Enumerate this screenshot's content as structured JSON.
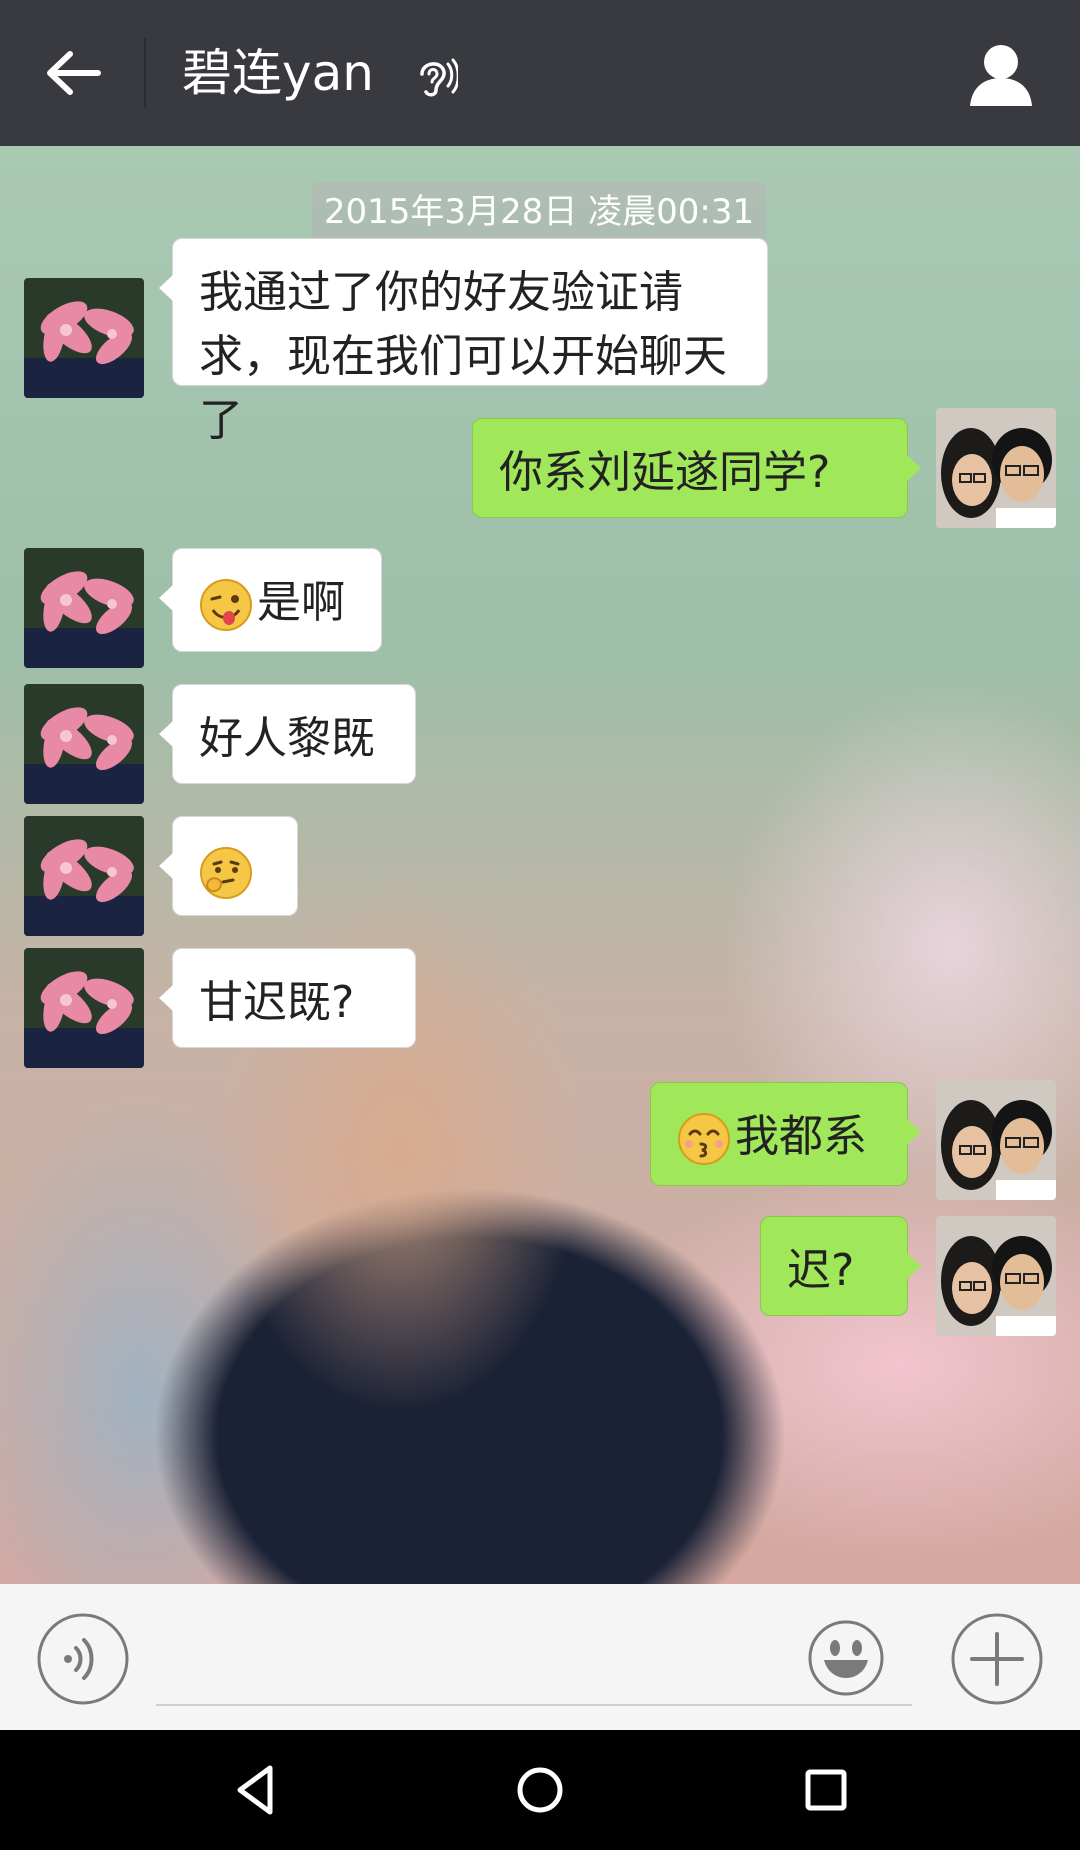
{
  "header": {
    "title": "碧连yan",
    "back_icon": "arrow-left-icon",
    "earpiece_icon": "ear-icon",
    "profile_icon": "person-icon"
  },
  "chat": {
    "timestamp": "2015年3月28日 凌晨00:31",
    "messages": [
      {
        "side": "in",
        "text": "我通过了你的好友验证请求，现在我们可以开始聊天了"
      },
      {
        "side": "out",
        "text": "你系刘延遂同学?"
      },
      {
        "side": "in",
        "emoji": "wink-tongue-emoji",
        "text": "是啊"
      },
      {
        "side": "in",
        "text": "好人黎既"
      },
      {
        "side": "in",
        "emoji": "thinking-emoji",
        "text": ""
      },
      {
        "side": "in",
        "text": "甘迟既?"
      },
      {
        "side": "out",
        "emoji": "kissing-emoji",
        "text": "我都系"
      },
      {
        "side": "out",
        "text": "迟?"
      }
    ]
  },
  "input": {
    "voice_icon": "voice-icon",
    "emoji_icon": "smiley-icon",
    "plus_icon": "plus-icon"
  },
  "colors": {
    "appbar": "#393a3f",
    "bubble_out": "#a0e75a",
    "bubble_in": "#ffffff"
  }
}
